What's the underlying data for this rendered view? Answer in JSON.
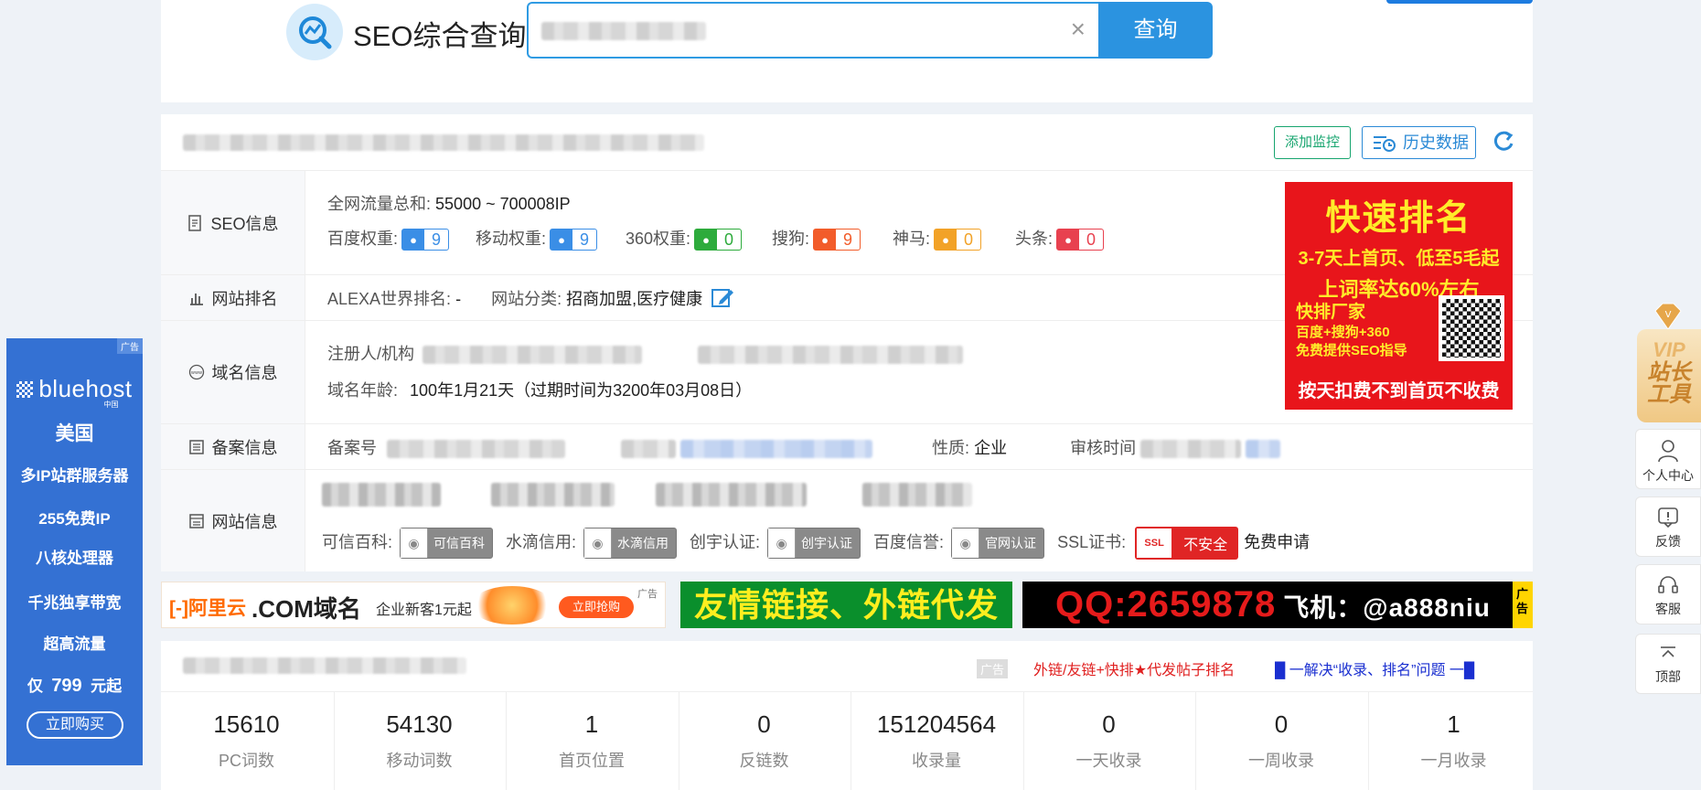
{
  "header": {
    "site_title": "SEO综合查询",
    "search_button": "查询",
    "clear_symbol": "×"
  },
  "info": {
    "add_monitor": "添加监控",
    "history": "历史数据",
    "seo": {
      "label": "SEO信息",
      "total_traffic_label": "全网流量总和:",
      "total_traffic_value": "55000 ~ 700008IP",
      "weights": [
        {
          "label": "百度权重:",
          "value": "9",
          "icon": "baidu-paw",
          "color": "#3a8ee6"
        },
        {
          "label": "移动权重:",
          "value": "9",
          "icon": "baidu-paw",
          "color": "#3a8ee6"
        },
        {
          "label": "360权重:",
          "value": "0",
          "icon": "360-logo",
          "color": "#2dab3c"
        },
        {
          "label": "搜狗:",
          "value": "9",
          "icon": "sogou-logo",
          "color": "#f25c2a"
        },
        {
          "label": "神马:",
          "value": "0",
          "icon": "shenma-logo",
          "color": "#f2a227"
        },
        {
          "label": "头条:",
          "value": "0",
          "icon": "toutiao-logo",
          "color": "#e8414f"
        }
      ]
    },
    "rank": {
      "label": "网站排名",
      "alexa_label": "ALEXA世界排名:",
      "alexa_value": "-",
      "category_label": "网站分类:",
      "category_value": "招商加盟,医疗健康"
    },
    "domain": {
      "label": "域名信息",
      "registrant_label": "注册人/机构",
      "age_label": "域名年龄:",
      "age_value": "100年1月21天（过期时间为3200年03月08日）"
    },
    "icp": {
      "label": "备案信息",
      "number_label": "备案号",
      "nature_label": "性质:",
      "nature_value": "企业",
      "review_label": "审核时间"
    },
    "site": {
      "label": "网站信息",
      "certs": [
        {
          "label": "可信百科:",
          "badge": "可信百科"
        },
        {
          "label": "水滴信用:",
          "badge": "水滴信用"
        },
        {
          "label": "创宇认证:",
          "badge": "创宇认证"
        },
        {
          "label": "百度信誉:",
          "badge": "官网认证"
        }
      ],
      "ssl_label": "SSL证书:",
      "ssl_badge_icon": "SSL",
      "ssl_status": "不安全",
      "ssl_apply": "免费申请"
    }
  },
  "right_ad": {
    "line1": "快速排名",
    "line2": "3-7天上首页、低至5毛起",
    "line3": "上词率达60%左右",
    "line4": "快排厂家",
    "line5a": "百度+搜狗+360",
    "line5b": "免费提供SEO指导",
    "line6": "按天扣费不到首页不收费"
  },
  "banners": {
    "aliyun_logo": "[-]阿里云",
    "aliyun_title": ".COM域名",
    "aliyun_offer": "企业新客1元起",
    "aliyun_buy": "立即抢购",
    "ad_tag": "广告",
    "green_text": "友情链接、外链代发",
    "qq_text": "QQ:2659878",
    "qq_plane": "飞机：@a888niu",
    "qq_ad": "广告"
  },
  "stats": {
    "ad_label": "广告",
    "link1": "外链/友链+快排★代发帖子排名",
    "link2": "█ 一解决“收录、排名”问题 一█",
    "items": [
      {
        "value": "15610",
        "label": "PC词数"
      },
      {
        "value": "54130",
        "label": "移动词数"
      },
      {
        "value": "1",
        "label": "首页位置"
      },
      {
        "value": "0",
        "label": "反链数"
      },
      {
        "value": "151204564",
        "label": "收录量"
      },
      {
        "value": "0",
        "label": "一天收录"
      },
      {
        "value": "0",
        "label": "一周收录"
      },
      {
        "value": "1",
        "label": "一月收录"
      }
    ]
  },
  "left_ad": {
    "tag": "广告",
    "brand": "bluehost",
    "brand_sub": "中国",
    "lines": [
      "美国",
      "多IP站群服务器",
      "255免费IP",
      "八核处理器",
      "千兆独享带宽",
      "超高流量"
    ],
    "price_prefix": "仅",
    "price": "799",
    "price_suffix": "元起",
    "buy": "立即购买"
  },
  "tools": {
    "vip_top": "VIP",
    "vip_line1": "站长",
    "vip_line2": "工具",
    "items": [
      {
        "label": "个人中心",
        "icon": "user-icon"
      },
      {
        "label": "反馈",
        "icon": "feedback-icon"
      },
      {
        "label": "客服",
        "icon": "headset-icon"
      },
      {
        "label": "顶部",
        "icon": "arrow-up-icon"
      }
    ]
  }
}
